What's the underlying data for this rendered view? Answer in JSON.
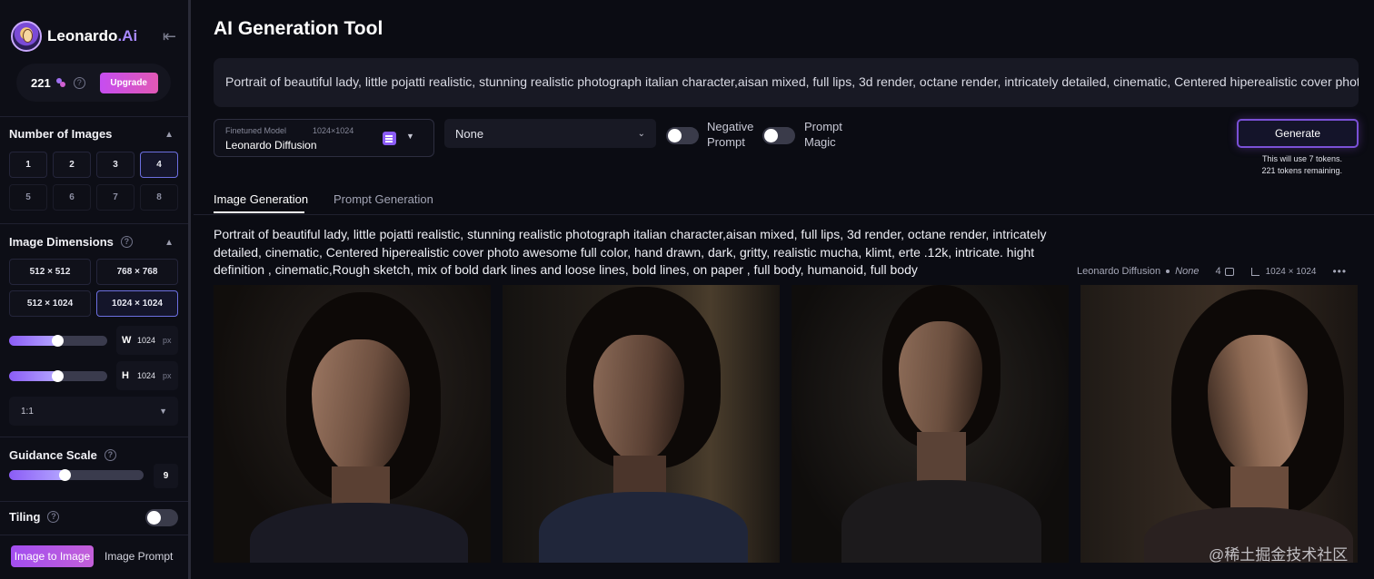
{
  "brand": {
    "name": "Leonardo",
    "suffix": ".Ai"
  },
  "sidebar": {
    "tokens": "221",
    "upgrade_label": "Upgrade",
    "number_of_images": {
      "title": "Number of Images",
      "options": [
        "1",
        "2",
        "3",
        "4",
        "5",
        "6",
        "7",
        "8"
      ],
      "selected": "4"
    },
    "image_dimensions": {
      "title": "Image Dimensions",
      "options": [
        "512 × 512",
        "768 × 768",
        "512 × 1024",
        "1024 × 1024"
      ],
      "selected": "1024 × 1024"
    },
    "width": {
      "label": "W",
      "value": "1024",
      "unit": "px",
      "slider_fraction": 0.5
    },
    "height": {
      "label": "H",
      "value": "1024",
      "unit": "px",
      "slider_fraction": 0.5
    },
    "aspect_ratio": "1:1",
    "guidance_scale": {
      "title": "Guidance Scale",
      "value": "9",
      "slider_fraction": 0.42
    },
    "tiling": {
      "title": "Tiling",
      "enabled": false
    },
    "bottom_tabs": {
      "image_to_image": "Image to Image",
      "image_prompt": "Image Prompt"
    }
  },
  "main": {
    "title": "AI Generation Tool",
    "prompt": "Portrait of beautiful lady, little pojatti realistic, stunning realistic photograph italian character,aisan mixed, full lips, 3d render, octane render, intricately detailed, cinematic, Centered hiperealistic cover phot",
    "model": {
      "label": "Finetuned Model",
      "resolution": "1024×1024",
      "name": "Leonardo Diffusion"
    },
    "style_value": "None",
    "negative_prompt": {
      "label_line1": "Negative",
      "label_line2": "Prompt",
      "enabled": false
    },
    "prompt_magic": {
      "label_line1": "Prompt",
      "label_line2": "Magic",
      "enabled": false
    },
    "generate_label": "Generate",
    "token_note_line1": "This will use 7 tokens.",
    "token_note_line2": "221 tokens remaining.",
    "tabs": [
      "Image Generation",
      "Prompt Generation"
    ],
    "generation": {
      "prompt": "Portrait of beautiful lady, little pojatti realistic, stunning realistic photograph italian character,aisan mixed, full lips, 3d render, octane render, intricately detailed, cinematic, Centered hiperealistic cover photo awesome full color, hand drawn, dark, gritty, realistic mucha, klimt, erte .12k, intricate. hight definition , cinematic,Rough sketch, mix of bold dark lines and loose lines, bold lines, on paper , full body, humanoid, full body",
      "model": "Leonardo Diffusion",
      "style": "None",
      "image_count": "4",
      "resolution": "1024 × 1024"
    }
  },
  "watermark": "@稀土掘金技术社区",
  "colors": {
    "accent": "#8b5cf6",
    "upgrade": "#d24fd8",
    "background": "#0b0c13"
  }
}
